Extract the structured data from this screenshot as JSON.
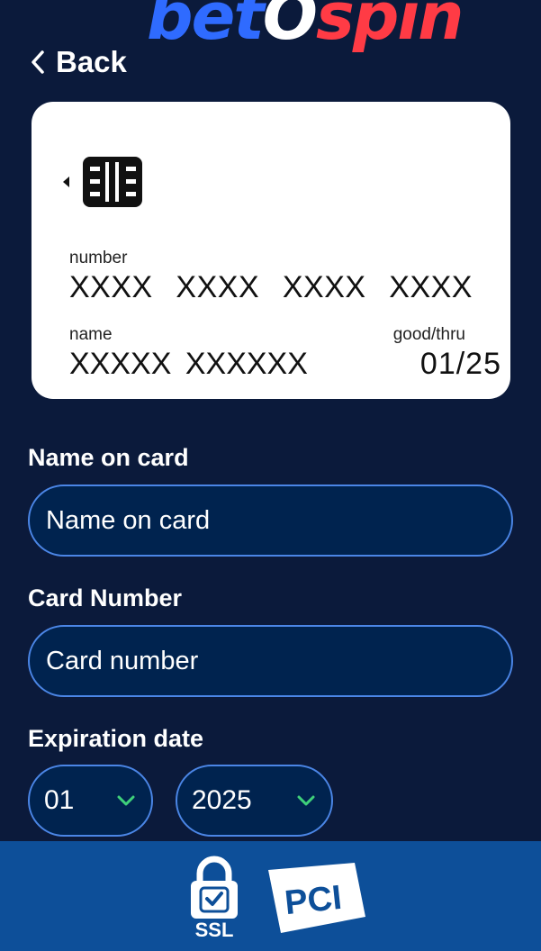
{
  "brand": {
    "part1": "bet",
    "part2": "O",
    "part3": "spin"
  },
  "nav": {
    "back_label": "Back"
  },
  "card_preview": {
    "number_label": "number",
    "number_groups": [
      "XXXX",
      "XXXX",
      "XXXX",
      "XXXX"
    ],
    "name_label": "name",
    "name_value": "XXXXX XXXXXX",
    "expiry_label": "good/thru",
    "expiry_value": "01/25"
  },
  "form": {
    "name_label": "Name on card",
    "name_placeholder": "Name on card",
    "number_label": "Card Number",
    "number_placeholder": "Card number",
    "expiry_label": "Expiration date",
    "month_value": "01",
    "year_value": "2025"
  },
  "footer": {
    "ssl_text": "SSL",
    "pci_text": "PCI"
  },
  "colors": {
    "background": "#0b1a3b",
    "input_bg": "#00234f",
    "input_border": "#4b86e6",
    "chevron": "#3fd07a",
    "footer_bg": "#0d4f99",
    "brand_blue": "#2f6bff",
    "brand_red": "#ff3b45"
  }
}
